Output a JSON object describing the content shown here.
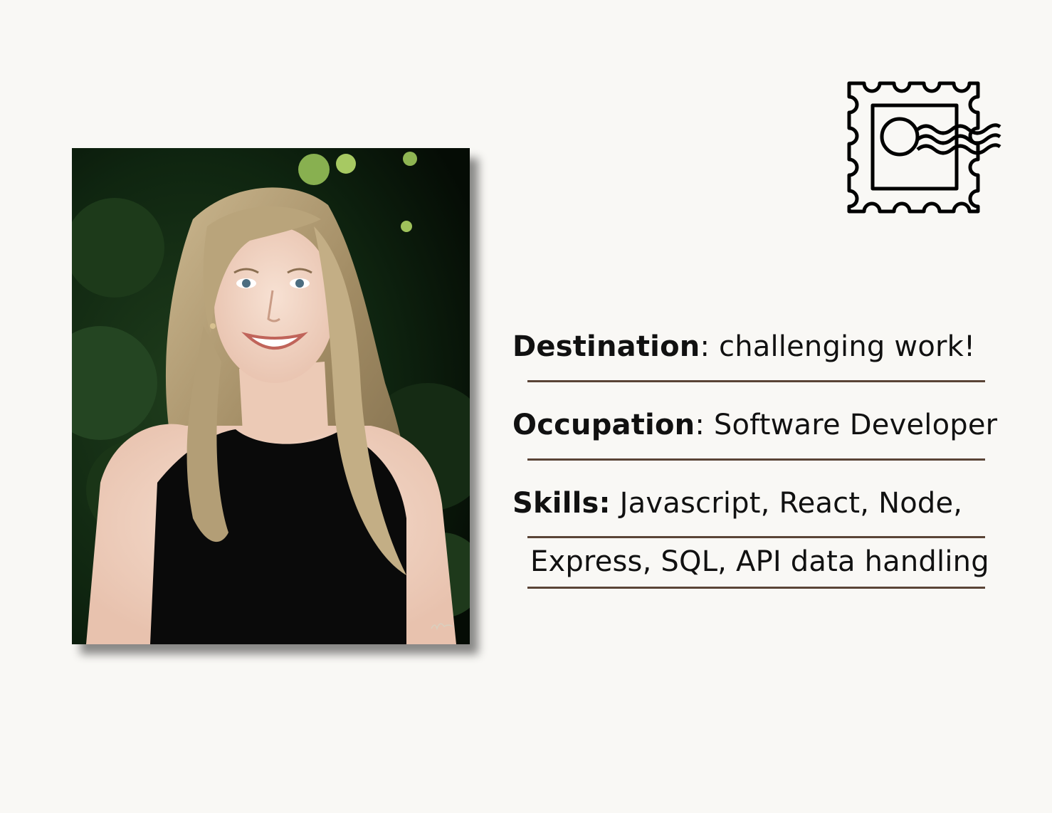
{
  "profile": {
    "destination_label": "Destination",
    "destination_value": ": challenging work!",
    "occupation_label": "Occupation",
    "occupation_value": ": Software Developer",
    "skills_label": "Skills:",
    "skills_value_line1": " Javascript, React, Node,",
    "skills_value_line2": "Express, SQL, API data handling"
  },
  "icons": {
    "stamp": "postage-stamp-icon"
  },
  "colors": {
    "background": "#f9f8f5",
    "rule": "#5a4436",
    "text": "#111111"
  }
}
